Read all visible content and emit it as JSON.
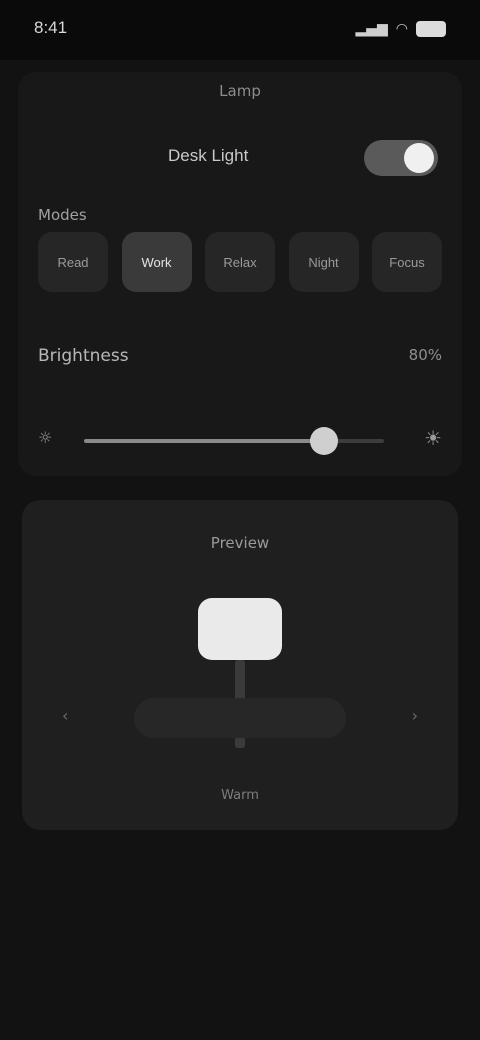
{
  "status": {
    "time": "8:41",
    "signal_icon": "signal-icon",
    "wifi_icon": "wifi-icon",
    "battery_icon": "battery-icon"
  },
  "panel": {
    "title": "Lamp",
    "power_label": "Desk Light",
    "power_on": true,
    "modes_label": "Modes",
    "modes": [
      {
        "label": "Read",
        "active": false
      },
      {
        "label": "Work",
        "active": true
      },
      {
        "label": "Relax",
        "active": false
      },
      {
        "label": "Night",
        "active": false
      },
      {
        "label": "Focus",
        "active": false
      }
    ],
    "brightness_label": "Brightness",
    "brightness_value": "80%",
    "brightness_level": 0.8
  },
  "preview": {
    "title": "Preview",
    "caption": "Warm"
  },
  "colors": {
    "background": "#121212",
    "panel": "#181818",
    "accent": "#eaeaea"
  }
}
